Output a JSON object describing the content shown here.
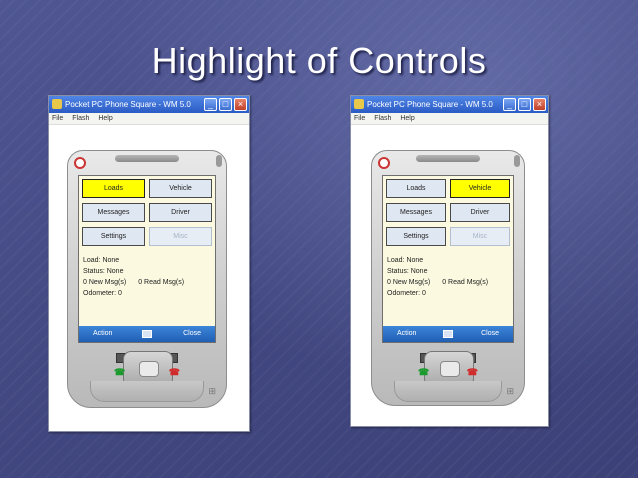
{
  "slide": {
    "title": "Highlight of Controls"
  },
  "emulators": [
    {
      "window_title": "Pocket PC Phone Square - WM 5.0",
      "menu": [
        "File",
        "Flash",
        "Help"
      ],
      "buttons": [
        {
          "label": "Loads",
          "state": "highlighted"
        },
        {
          "label": "Vehicle",
          "state": "normal"
        },
        {
          "label": "Messages",
          "state": "normal"
        },
        {
          "label": "Driver",
          "state": "normal"
        },
        {
          "label": "Settings",
          "state": "normal"
        },
        {
          "label": "Misc",
          "state": "disabled"
        }
      ],
      "status": {
        "load": "Load: None",
        "status": "Status: None",
        "new_msgs": "0 New Msg(s)",
        "read_msgs": "0 Read Msg(s)",
        "odometer": "Odometer: 0"
      },
      "softkeys": {
        "left": "Action",
        "right": "Close"
      }
    },
    {
      "window_title": "Pocket PC Phone Square - WM 5.0",
      "menu": [
        "File",
        "Flash",
        "Help"
      ],
      "buttons": [
        {
          "label": "Loads",
          "state": "normal"
        },
        {
          "label": "Vehicle",
          "state": "highlighted"
        },
        {
          "label": "Messages",
          "state": "normal"
        },
        {
          "label": "Driver",
          "state": "normal"
        },
        {
          "label": "Settings",
          "state": "normal"
        },
        {
          "label": "Misc",
          "state": "disabled"
        }
      ],
      "status": {
        "load": "Load: None",
        "status": "Status: None",
        "new_msgs": "0 New Msg(s)",
        "read_msgs": "0 Read Msg(s)",
        "odometer": "Odometer: 0"
      },
      "softkeys": {
        "left": "Action",
        "right": "Close"
      }
    }
  ],
  "colors": {
    "highlight": "#ffff00",
    "softbar": "#2a6cc2",
    "screen_bg": "#fbfae0"
  }
}
